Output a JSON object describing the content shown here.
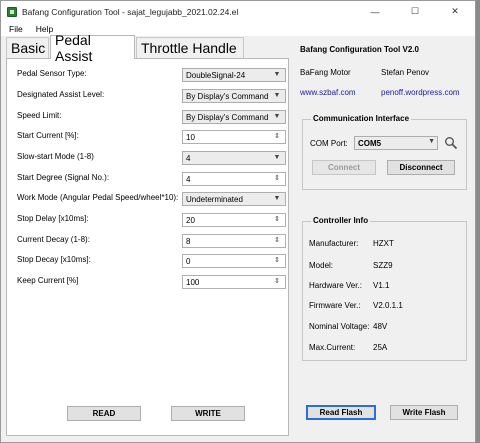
{
  "window": {
    "title": "Bafang Configuration Tool - sajat_legujabb_2021.02.24.el",
    "controls": {
      "minimize": "—",
      "maximize": "☐",
      "close": "✕"
    }
  },
  "menu": {
    "file": "File",
    "help": "Help"
  },
  "tabs": {
    "basic": "Basic",
    "pedal_assist": "Pedal Assist",
    "throttle": "Throttle Handle"
  },
  "pedal": {
    "rows": [
      {
        "label": "Pedal Sensor Type:",
        "value": "DoubleSignal-24",
        "kind": "select"
      },
      {
        "label": "Designated Assist Level:",
        "value": "By Display's Command",
        "kind": "select"
      },
      {
        "label": "Speed Limit:",
        "value": "By Display's Command",
        "kind": "select"
      },
      {
        "label": "Start Current [%]:",
        "value": "10",
        "kind": "spin"
      },
      {
        "label": "Slow-start Mode (1-8)",
        "value": "4",
        "kind": "select"
      },
      {
        "label": "Start Degree (Signal No.):",
        "value": "4",
        "kind": "spin"
      },
      {
        "label": "Work Mode (Angular Pedal Speed/wheel*10):",
        "value": "Undeterminated",
        "kind": "select"
      },
      {
        "label": "Stop Delay [x10ms]:",
        "value": "20",
        "kind": "spin"
      },
      {
        "label": "Current Decay (1-8):",
        "value": "8",
        "kind": "spin"
      },
      {
        "label": "Stop Decay [x10ms]:",
        "value": "0",
        "kind": "spin"
      },
      {
        "label": "Keep Current [%]",
        "value": "100",
        "kind": "spin"
      }
    ],
    "read_label": "READ",
    "write_label": "WRITE"
  },
  "info": {
    "title": "Bafang Configuration Tool V2.0",
    "company": "BaFang Motor",
    "author": "Stefan Penov",
    "link1": "www.szbaf.com",
    "link2": "penoff.wordpress.com"
  },
  "comm": {
    "group_title": "Communication Interface",
    "port_label": "COM Port:",
    "port_value": "COM5",
    "connect_label": "Connect",
    "disconnect_label": "Disconnect"
  },
  "controller": {
    "group_title": "Controller Info",
    "fields": [
      {
        "label": "Manufacturer:",
        "value": "HZXT"
      },
      {
        "label": "Model:",
        "value": "SZZ9"
      },
      {
        "label": "Hardware Ver.:",
        "value": "V1.1"
      },
      {
        "label": "Firmware Ver.:",
        "value": "V2.0.1.1"
      },
      {
        "label": "Nominal Voltage:",
        "value": "48V"
      },
      {
        "label": "Max.Current:",
        "value": "25A"
      }
    ]
  },
  "flash": {
    "read_label": "Read Flash",
    "write_label": "Write Flash"
  }
}
